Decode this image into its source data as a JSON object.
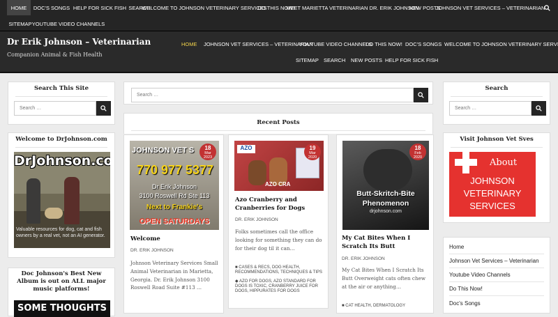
{
  "top_nav": [
    "Home",
    "Doc's Songs",
    "Help For Sick Fish",
    "Search",
    "Welcome to Johnson Veterinary Services",
    "Do This Now!",
    "Meet Marietta Veterinarian Dr. Erik Johnson",
    "New Posts",
    "Johnson Vet Services – Veterinarian",
    "Sitemap",
    "Youtube Video Channels"
  ],
  "site": {
    "title": "Dr Erik Johnson – Veterinarian",
    "description": "Companion Animal & Fish Health"
  },
  "header_nav": [
    "Home",
    "Johnson Vet Services – Veterinarian",
    "Youtube Video Channels",
    "Do This Now!",
    "Doc's Songs",
    "Welcome to Johnson Veterinary Services",
    "Sitemap",
    "Search",
    "New Posts",
    "Help For Sick Fish"
  ],
  "left": {
    "search_title": "Search This Site",
    "search_placeholder": "Search …",
    "welcome_title": "Welcome to DrJohnson.com",
    "welcome_img_text": "DrJohnson.com",
    "welcome_caption": "Valuable resources for dog, cat and fish owners by a real vet, not an AI generator.",
    "album_title": "Doc Johnson's Best New Album is out on ALL major music platforms!",
    "album_img_text": "SOME THOUGHTS"
  },
  "center": {
    "search_placeholder": "Search …",
    "recent_title": "Recent Posts",
    "posts": [
      {
        "title": "Welcome",
        "meta": "Dr. Erik Johnson",
        "day": "18",
        "month": "Mar",
        "year": "2023",
        "excerpt": "Johnson Veterinary Services Small Animal Veterinarian in Marietta, Georgia. Dr. Erik Johnson 3100 Roswell Road Suite #113 …",
        "img": {
          "line1": "JOHNSON VET S",
          "phone": "770 977 5377",
          "l3": "Dr Erik Johnson",
          "l4": "3100 Roswell Rd Ste 113",
          "l5": "Next to Frankie's",
          "l6": "OPEN SATURDAYS"
        }
      },
      {
        "title": "Azo Cranberry and Cranberries for Dogs",
        "meta": "Dr. Erik Johnson",
        "day": "19",
        "month": "Mar",
        "year": "2020",
        "excerpt": "Folks sometimes call the office looking for something they can do for their dog til it can…",
        "cats": "Cases & Recs, Dog Health, Recommendations, Techniques & Tips",
        "tags": "AZO for Dogs, AZO Standard for Dogs is toxic, Cranberry Juice for Dogs, Hippurates for Dogs",
        "img": {
          "azo": "AZO",
          "label": "AZO CRA"
        }
      },
      {
        "title": "My Cat Bites When I Scratch Its Butt",
        "meta": "Dr. Erik Johnson",
        "day": "18",
        "month": "Feb",
        "year": "2020",
        "excerpt": "My Cat Bites When I Scratch Its Butt Overweight cats often chew at the air or anything…",
        "cats": "Cat Health, Dermatology",
        "img": {
          "line1": "Butt-Skritch-Bite",
          "line2": "Phenomenon",
          "line3": "drjohnson.com"
        }
      }
    ]
  },
  "right": {
    "search_title": "Search",
    "search_placeholder": "Search …",
    "visit_title": "Visit Johnson Vet Sves",
    "visit_img": {
      "l1": "About",
      "l2": "JOHNSON",
      "l3": "VETERINARY",
      "l4": "SERVICES"
    },
    "menu": [
      "Home",
      "Johnson Vet Services – Veterinarian",
      "Youtube Video Channels",
      "Do This Now!",
      "Doc's Songs"
    ]
  }
}
